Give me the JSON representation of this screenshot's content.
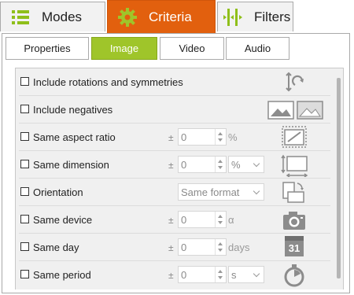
{
  "main_tabs": [
    {
      "label": "Modes",
      "icon": "list-icon"
    },
    {
      "label": "Criteria",
      "icon": "gear-icon"
    },
    {
      "label": "Filters",
      "icon": "filter-icon"
    }
  ],
  "active_main_tab": "Criteria",
  "sub_tabs": [
    {
      "label": "Properties"
    },
    {
      "label": "Image"
    },
    {
      "label": "Video"
    },
    {
      "label": "Audio"
    }
  ],
  "active_sub_tab": "Image",
  "options": [
    {
      "label": "Include rotations and symmetries",
      "checked": false,
      "icon": "rotation-icon"
    },
    {
      "label": "Include negatives",
      "checked": false,
      "icon": "negative-icon"
    },
    {
      "label": "Same aspect ratio",
      "checked": false,
      "plus_minus": "±",
      "value": "0",
      "unit": "%",
      "icon": "aspect-ratio-icon"
    },
    {
      "label": "Same dimension",
      "checked": false,
      "plus_minus": "±",
      "value": "0",
      "select": "%",
      "icon": "dimension-icon"
    },
    {
      "label": "Orientation",
      "checked": false,
      "select": "Same format",
      "icon": "orientation-icon"
    },
    {
      "label": "Same device",
      "checked": false,
      "plus_minus": "±",
      "value": "0",
      "unit": "α",
      "icon": "camera-icon"
    },
    {
      "label": "Same day",
      "checked": false,
      "plus_minus": "±",
      "value": "0",
      "unit": "days",
      "icon": "calendar-icon",
      "calendar_day": "31"
    },
    {
      "label": "Same period",
      "checked": false,
      "plus_minus": "±",
      "value": "0",
      "select": "s",
      "icon": "timer-icon"
    }
  ],
  "colors": {
    "active_main_tab": "#e2600e",
    "active_sub_tab": "#9fc52a",
    "icon_green": "#8fbf1a",
    "icon_gray": "#8c8c8c"
  }
}
